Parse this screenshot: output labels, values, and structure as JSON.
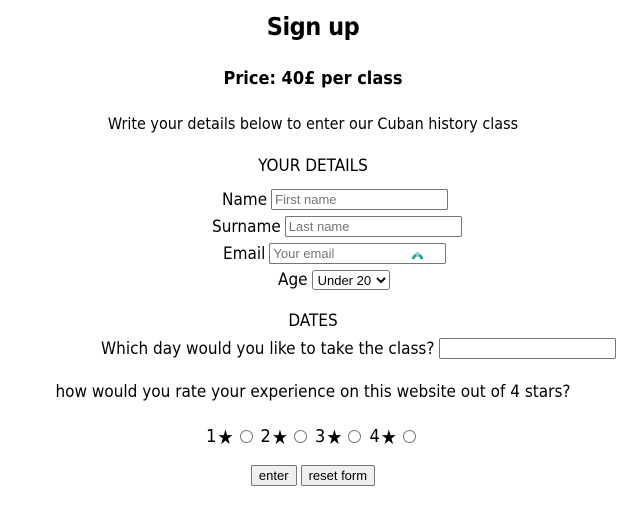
{
  "title": "Sign up",
  "price": "Price: 40£ per class",
  "intro": "Write your details below to enter our Cuban history class",
  "details_heading": "YOUR DETAILS",
  "fields": {
    "name_label": "Name",
    "name_placeholder": "First name",
    "surname_label": "Surname",
    "surname_placeholder": "Last name",
    "email_label": "Email",
    "email_placeholder": "Your email",
    "age_label": "Age",
    "age_selected": "Under 20"
  },
  "dates_heading": "DATES",
  "date_question": "Which day would you like to take the class?",
  "rating_question": "how would you rate your experience on this website out of 4 stars?",
  "ratings": [
    "1",
    "2",
    "3",
    "4"
  ],
  "star_glyph": "★",
  "buttons": {
    "enter": "enter",
    "reset": "reset form"
  },
  "icons": {
    "email_field_extension": "password-manager-icon",
    "rating_star": "star-icon"
  },
  "colors": {
    "extension_icon": "#2a9d8f"
  }
}
